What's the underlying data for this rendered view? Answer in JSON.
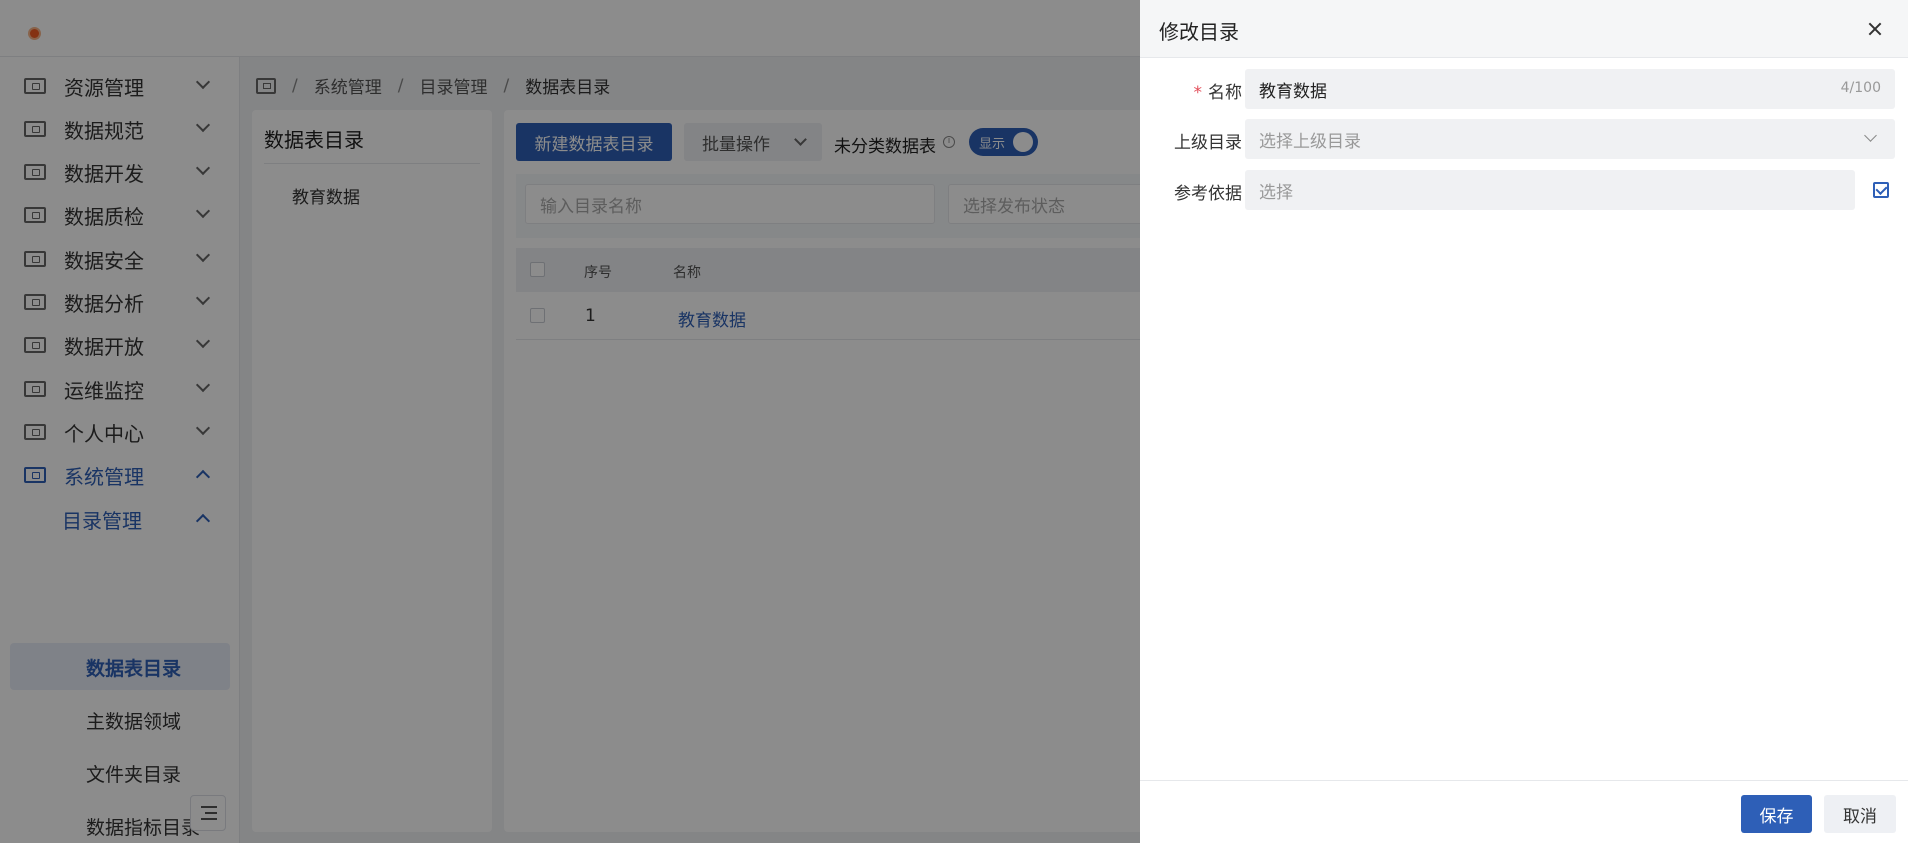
{
  "sidebar": {
    "items": [
      {
        "label": "资源管理"
      },
      {
        "label": "数据规范"
      },
      {
        "label": "数据开发"
      },
      {
        "label": "数据质检"
      },
      {
        "label": "数据安全"
      },
      {
        "label": "数据分析"
      },
      {
        "label": "数据开放"
      },
      {
        "label": "运维监控"
      },
      {
        "label": "个人中心"
      },
      {
        "label": "系统管理"
      }
    ],
    "submenu": {
      "label": "目录管理"
    },
    "leaves": [
      {
        "label": "数据表目录"
      },
      {
        "label": "主数据领域"
      },
      {
        "label": "文件夹目录"
      },
      {
        "label": "数据指标目录"
      }
    ]
  },
  "breadcrumb": [
    "系统管理",
    "目录管理",
    "数据表目录"
  ],
  "breadcrumb_sep": "/",
  "tree": {
    "title": "数据表目录",
    "node": "教育数据"
  },
  "toolbar": {
    "new_label": "新建数据表目录",
    "batch_label": "批量操作",
    "uncategorized_label": "未分类数据表",
    "info_glyph": "i",
    "switch_label": "显示"
  },
  "filters": {
    "name_placeholder": "输入目录名称",
    "status_placeholder": "选择发布状态"
  },
  "table": {
    "headers": [
      "序号",
      "名称"
    ],
    "rows": [
      {
        "index": "1",
        "name": "教育数据"
      }
    ]
  },
  "drawer": {
    "title": "修改目录",
    "required_mark": "*",
    "fields": {
      "name": {
        "label": "名称",
        "value": "教育数据",
        "counter": "4/100"
      },
      "parent": {
        "label": "上级目录",
        "placeholder": "选择上级目录"
      },
      "reference": {
        "label": "参考依据",
        "placeholder": "选择"
      }
    },
    "save_label": "保存",
    "cancel_label": "取消"
  }
}
